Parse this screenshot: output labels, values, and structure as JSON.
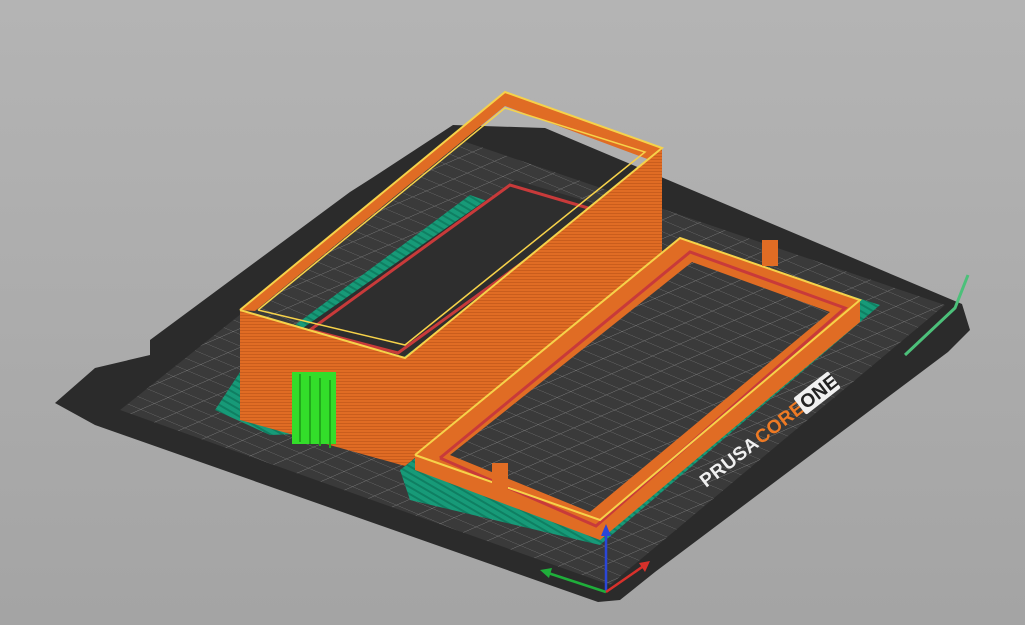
{
  "bed": {
    "brand": "PRUSA",
    "model_word": "CORE",
    "model_badge": "ONE",
    "colors": {
      "sheet": "#2b2b2b",
      "bed_surface": "#3a3a3a",
      "grid": "#8a8a8a",
      "brand_text": "#f0f0f0",
      "brand_accent": "#ee7a24"
    }
  },
  "toolpaths": {
    "colors": {
      "wall": "#e06c24",
      "wall_highlight": "#f6d24a",
      "infill": "#c83a3a",
      "skirt": "#179a78",
      "support": "#33dd2a"
    }
  },
  "axes": {
    "x_color": "#d8312b",
    "y_color": "#1fae3a",
    "z_color": "#2a46d8"
  },
  "wipe_tower_color": "#4cc07a"
}
